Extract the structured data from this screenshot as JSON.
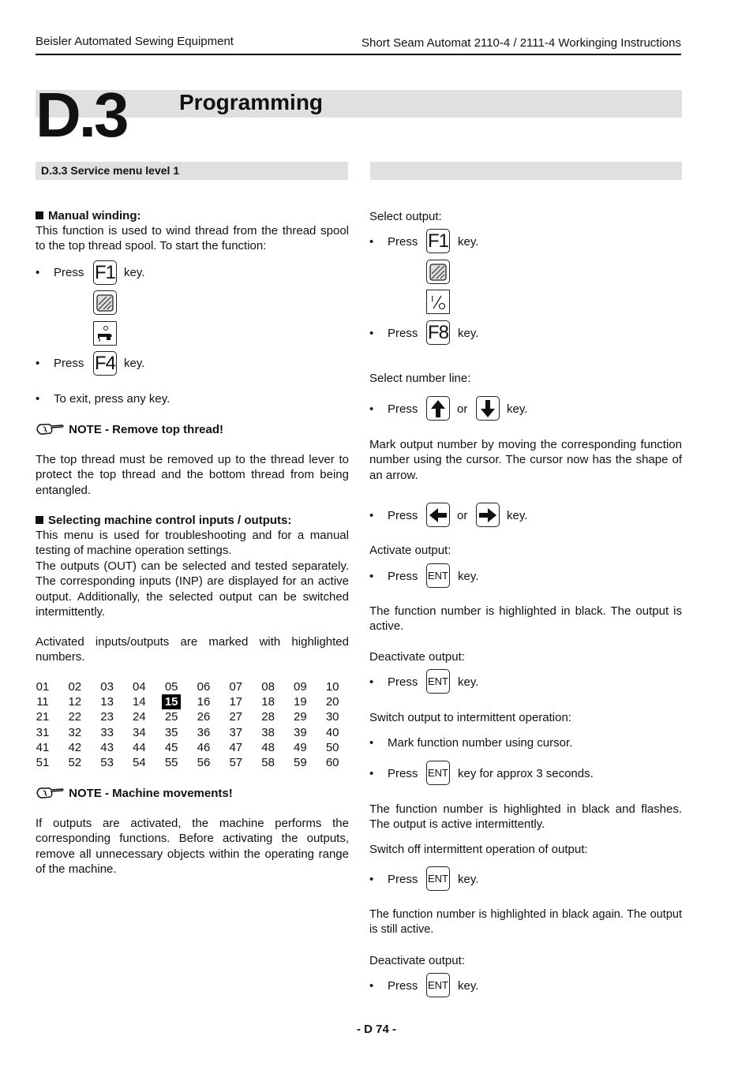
{
  "header": {
    "left": "Beisler Automated Sewing Equipment",
    "right": "Short Seam Automat 2110-4 / 2111-4 Workinging Instructions"
  },
  "chapter": {
    "number": "D.3",
    "title": "Programming"
  },
  "section": {
    "title": "D.3.3 Service menu level 1"
  },
  "left": {
    "manual_winding": {
      "heading": "Manual winding:",
      "text": "This function is used to wind thread from the thread spool to the top thread spool. To start the function:",
      "press": "Press",
      "key_word": "key.",
      "key_f1": "F1",
      "key_f4": "F4",
      "exit": "To exit, press any key."
    },
    "note1": {
      "title": "NOTE - Remove top thread!",
      "text": "The top thread must be removed up to the thread lever to protect the top thread and the bottom thread from being entangled."
    },
    "io": {
      "heading": "Selecting machine control inputs / outputs:",
      "text1": "This menu is used for troubleshooting and for a manual testing of machine operation settings.",
      "text2": "The outputs (OUT) can be selected and tested separately. The corresponding inputs (INP) are displayed for an active output. Additionally, the selected output can be switched intermittently.",
      "text3": "Activated inputs/outputs are marked with highlighted numbers."
    },
    "grid": {
      "numbers": [
        [
          "01",
          "02",
          "03",
          "04",
          "05",
          "06",
          "07",
          "08",
          "09",
          "10"
        ],
        [
          "11",
          "12",
          "13",
          "14",
          "15",
          "16",
          "17",
          "18",
          "19",
          "20"
        ],
        [
          "21",
          "22",
          "23",
          "24",
          "25",
          "26",
          "27",
          "28",
          "29",
          "30"
        ],
        [
          "31",
          "32",
          "33",
          "34",
          "35",
          "36",
          "37",
          "38",
          "39",
          "40"
        ],
        [
          "41",
          "42",
          "43",
          "44",
          "45",
          "46",
          "47",
          "48",
          "49",
          "50"
        ],
        [
          "51",
          "52",
          "53",
          "54",
          "55",
          "56",
          "57",
          "58",
          "59",
          "60"
        ]
      ],
      "highlighted": [
        "15"
      ]
    },
    "note2": {
      "title": "NOTE - Machine movements!",
      "text": "If outputs are activated, the machine performs the corresponding functions. Before activating the outputs, remove all unnecessary objects within the operating range of the machine."
    }
  },
  "right": {
    "select_output": "Select output:",
    "press": "Press",
    "key_word": "key.",
    "or": "or",
    "key_f1": "F1",
    "key_f8": "F8",
    "key_ent": "ENT",
    "io_symbol": "I/O",
    "select_line": "Select number line:",
    "mark_text": "Mark output number by moving the corresponding function number using the cursor. The cursor now has the shape of an arrow.",
    "activate": "Activate output:",
    "activated_text": "The function number is highlighted in black. The output is active.",
    "deactivate": "Deactivate output:",
    "switch_intermittent": "Switch output to intermittent operation:",
    "mark_cursor": "Mark function number using cursor.",
    "key_3s": "key for approx 3 seconds.",
    "flashes_text": "The function number is highlighted in black and flashes. The output is active intermittently.",
    "switch_off": "Switch off intermittent operation of output:",
    "again_text": "The function number is highlighted in black again. The output is still active.",
    "deactivate2": "Deactivate output:"
  },
  "footer": {
    "page": "- D 74 -"
  }
}
